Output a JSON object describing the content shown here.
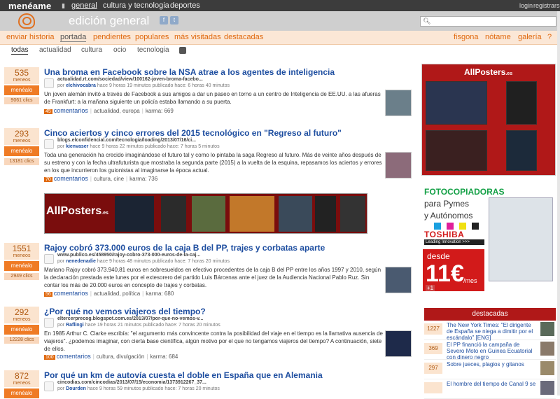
{
  "topbar": {
    "logo": "menéame",
    "nav": [
      "general",
      "cultura y tecnologia",
      "deportes"
    ],
    "login": "login",
    "register": "registrarse"
  },
  "header": {
    "section_title": "edición general",
    "social": [
      "f",
      "t"
    ]
  },
  "tabs": [
    "enviar historia",
    "portada",
    "pendientes",
    "populares",
    "más visitadas",
    "destacadas",
    "fisgona",
    "nótame",
    "galería",
    "?"
  ],
  "subtabs": [
    "todas",
    "actualidad",
    "cultura",
    "ocio",
    "tecnologia"
  ],
  "news": [
    {
      "votes": "535",
      "votes_label": "meneos",
      "button": "menéalo",
      "clicks": "9061 clics",
      "title": "Una broma en Facebook sobre la NSA atrae a los agentes de inteligencia",
      "url": "actualidad.rt.com/sociedad/view/100162-joven-broma-facebo...",
      "meta_pre": "por",
      "user": "elchivocabra",
      "meta_post": "hace 9 horas 19 minutos publicado hace: 6 horas 40 minutos",
      "body": "Un joven alemán invitó a través de Facebook a sus amigos a dar un paseo en torno a un centro de Inteligencia de EE.UU. a las afueras de Frankfurt: a la mañana siguiente un policía estaba llamando a su puerta.",
      "comments": "45",
      "comments_label": "comentarios",
      "tags": "actualidad, europa",
      "karma": "karma: 669"
    },
    {
      "votes": "293",
      "votes_label": "meneos",
      "button": "menéalo",
      "clicks": "13181 clics",
      "title": "Cinco aciertos y cinco errores del 2015 tecnológico en \"Regreso al futuro\"",
      "url": "blogs.elconfidencial.com/tecnologia/loading/2013/07/16/ci...",
      "meta_pre": "por",
      "user": "kienvaser",
      "meta_post": "hace 9 horas 22 minutos publicado hace: 7 horas 5 minutos",
      "body": "Toda una generación ha crecido imaginándose el futuro tal y como lo pintaba la saga Regreso al futuro. Más de veinte años después de su estreno y con la fecha ultrafuturista que mostraba la segunda parte (2015) a la vuelta de la esquina, repasamos los aciertos y errores en los que incurrieron los guionistas al imaginarse la época actual.",
      "comments": "70",
      "comments_label": "comentarios",
      "tags": "cultura, cine",
      "karma": "karma: 736"
    },
    {
      "votes": "1551",
      "votes_label": "meneos",
      "button": "menéalo",
      "clicks": "2949 clics",
      "title": "Rajoy cobró 373.000 euros de la caja B del PP, trajes y corbatas aparte",
      "url": "www.publico.es/458950/rajoy-cobro-373-000-euros-de-la-caj...",
      "meta_pre": "por",
      "user": "nenedenadie",
      "meta_post": "hace 9 horas 48 minutos publicado hace: 7 horas 20 minutos",
      "body": "Mariano Rajoy cobró 373.940,81 euros en sobresueldos en efectivo procedentes de la caja B del PP entre los años 1997 y 2010, según la declaración prestada este lunes por el extesorero del partido Luis Bárcenas ante el juez de la Audiencia Nacional Pablo Ruz. Sin contar los más de 20.000 euros en concepto de trajes y corbatas.",
      "comments": "56",
      "comments_label": "comentarios",
      "tags": "actualidad, política",
      "karma": "karma: 680"
    },
    {
      "votes": "292",
      "votes_label": "meneos",
      "button": "menéalo",
      "clicks": "12228 clics",
      "title": "¿Por qué no vemos viajeros del tiempo?",
      "url": "eltercerprecog.blogspot.com.es/2013/07/por-que-no-vemos-v...",
      "meta_pre": "por",
      "user": "Raflingi",
      "meta_post": "hace 19 horas 21 minutos publicado hace: 7 horas 20 minutos",
      "body": "En 1985 Arthur C. Clarke escribía: \"el argumento más convincente contra la posibilidad del viaje en el tiempo es la llamativa ausencia de viajeros\". ¿podemos imaginar, con cierta base científica, algún motivo por el que no tengamos viajeros del tiempo? A continuación, siete de ellos.",
      "comments": "100",
      "comments_label": "comentarios",
      "tags": "cultura, divulgación",
      "karma": "karma: 684"
    },
    {
      "votes": "872",
      "votes_label": "meneos",
      "button": "menéalo",
      "clicks": "",
      "title": "Por qué un km de autovía cuesta el doble en España que en Alemania",
      "url": "cincodias.com/cincodias/2013/07/15/economia/1373912267_37...",
      "meta_pre": "por",
      "user": "Dourden",
      "meta_post": "hace 9 horas 59 minutos publicado hace: 7 horas 20 minutos",
      "body": "",
      "comments": "",
      "comments_label": "",
      "tags": "",
      "karma": ""
    }
  ],
  "banner": {
    "brand": "AllPosters",
    "suffix": ".es"
  },
  "ad_top": {
    "brand": "AllPosters",
    "suffix": ".es"
  },
  "ad_foto": {
    "line1": "FOTOCOPIADORAS",
    "line2": "para Pymes",
    "line3": "y Autónomos",
    "brand": "TOSHIBA",
    "slogan": "Leading Innovation >>>",
    "from": "desde",
    "price": "11€",
    "per": "/mes",
    "plus": "+1"
  },
  "destacadas": {
    "heading": "destacadas",
    "items": [
      {
        "count": "1227",
        "title": "The New York Times: \"El dirigente de España se niega a dimitir por el escándalo\" [ENG]"
      },
      {
        "count": "369",
        "title": "El PP financió la campaña de Severo Moto en Guinea Ecuatorial con dinero negro"
      },
      {
        "count": "297",
        "title": "Sobre jueces, plagios y gitanos"
      },
      {
        "count": "",
        "title": "El hombre del tiempo de Canal 9 se"
      }
    ]
  },
  "colors": {
    "accent": "#e06a10",
    "link": "#1e4ea0",
    "vote_bg": "#fbe4cf",
    "topbar": "#3c3c3c"
  },
  "icons": [
    "search-icon",
    "rss-icon",
    "facebook-icon",
    "twitter-icon",
    "mascot-logo"
  ]
}
